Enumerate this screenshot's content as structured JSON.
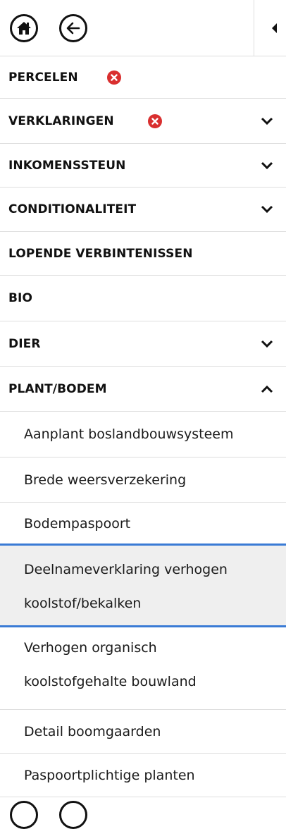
{
  "toolbar": {
    "home_icon": "home-icon",
    "back_icon": "arrow-left-icon",
    "collapse_icon": "caret-left-icon"
  },
  "menu": [
    {
      "label": "PERCELEN",
      "error": true,
      "chevron": null
    },
    {
      "label": "VERKLARINGEN",
      "error": true,
      "chevron": "down"
    },
    {
      "label": "INKOMENSSTEUN",
      "error": false,
      "chevron": "down"
    },
    {
      "label": "CONDITIONALITEIT",
      "error": false,
      "chevron": "down"
    },
    {
      "label": "LOPENDE VERBINTENISSEN",
      "error": false,
      "chevron": null
    },
    {
      "label": "BIO",
      "error": false,
      "chevron": null
    },
    {
      "label": "DIER",
      "error": false,
      "chevron": "down"
    },
    {
      "label": "PLANT/BODEM",
      "error": false,
      "chevron": "up"
    }
  ],
  "submenu": [
    {
      "label": "Aanplant boslandbouwsysteem",
      "active": false
    },
    {
      "label": "Brede weersverzekering",
      "active": false
    },
    {
      "label": "Bodempaspoort",
      "active": false
    },
    {
      "label": "Deelnameverklaring verhogen koolstof/bekalken",
      "line1": "Deelnameverklaring verhogen",
      "line2": "koolstof/bekalken",
      "active": true
    },
    {
      "label": "Verhogen organisch koolstofgehalte bouwland",
      "line1": "Verhogen organisch",
      "line2": "koolstofgehalte bouwland",
      "active": false
    },
    {
      "label": "Detail boomgaarden",
      "active": false
    },
    {
      "label": "Paspoortplichtige planten",
      "active": false
    }
  ],
  "colors": {
    "error": "#d92f2f",
    "active_border": "#3a7bd5",
    "active_bg": "#efefef"
  }
}
